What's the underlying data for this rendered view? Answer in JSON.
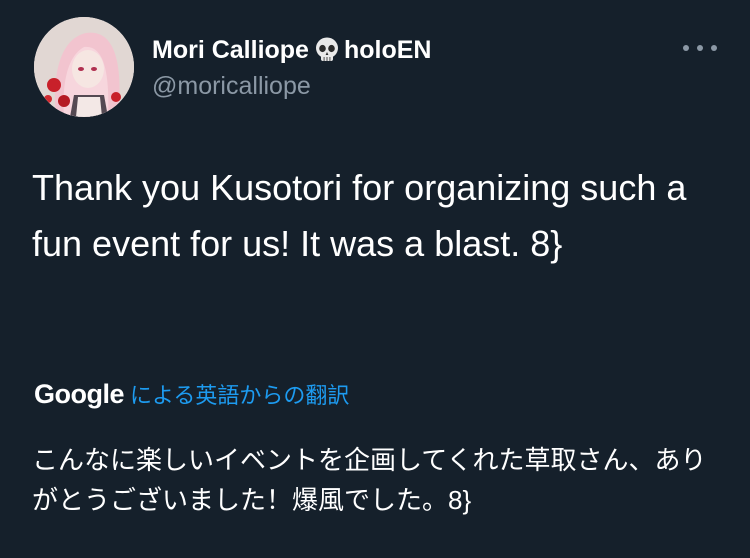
{
  "author": {
    "display_name": "Mori Calliope",
    "org": "holoEN",
    "handle": "@moricalliope",
    "name_emoji_icon": "skull-icon",
    "avatar_icon": "profile-avatar"
  },
  "menu": {
    "icon": "more-horizontal-icon"
  },
  "tweet": {
    "text": "Thank you Kusotori for organizing such a fun event for us! It was a blast. 8}"
  },
  "translation": {
    "provider": "Google",
    "label": "による英語からの翻訳",
    "text": "こんなに楽しいイベントを企画してくれた草取さん、ありがとうございました！爆風でした。8}"
  },
  "colors": {
    "background": "#15202b",
    "text_primary": "#ffffff",
    "text_secondary": "#8b98a5",
    "link": "#1d9bf0"
  }
}
